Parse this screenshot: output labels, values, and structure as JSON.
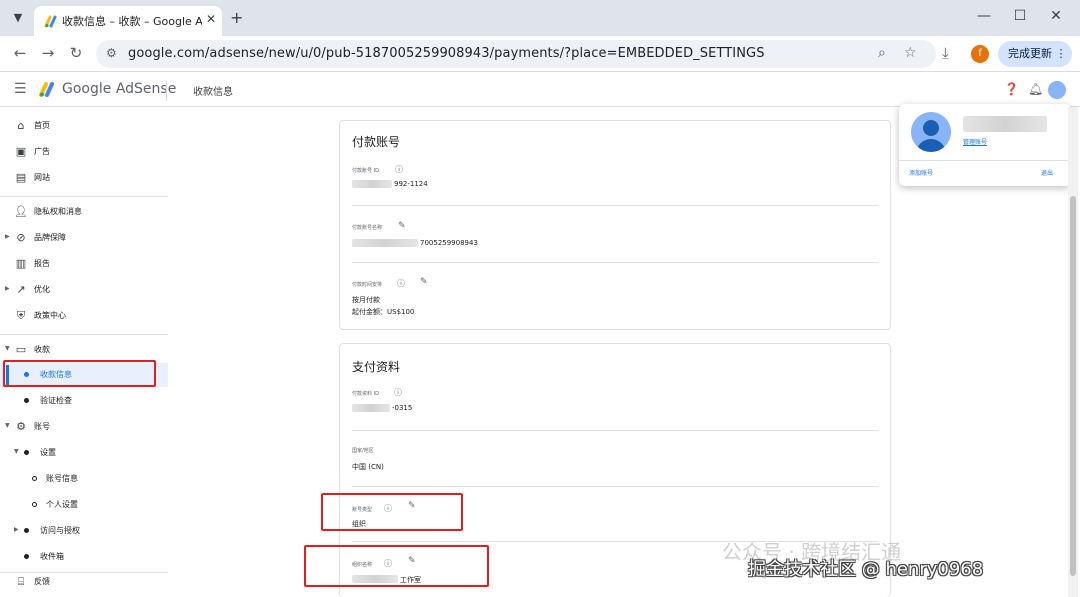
{
  "browser": {
    "tab_title": "收款信息 – 收款 – Google AdSense",
    "url": "google.com/adsense/new/u/0/pub-5187005259908943/payments/?place=EMBEDDED_SETTINGS",
    "update_label": "完成更新",
    "profile_initial": "f"
  },
  "app": {
    "logo_text": "Google AdSense",
    "page_title": "收款信息"
  },
  "sidebar": {
    "items": [
      {
        "label": "首页",
        "icon": "home-icon"
      },
      {
        "label": "广告",
        "icon": "ads-icon"
      },
      {
        "label": "网站",
        "icon": "sites-icon"
      },
      {
        "label": "隐私权和消息",
        "icon": "privacy-icon"
      },
      {
        "label": "品牌保障",
        "icon": "block-icon"
      },
      {
        "label": "报告",
        "icon": "report-icon"
      },
      {
        "label": "优化",
        "icon": "trend-icon"
      },
      {
        "label": "政策中心",
        "icon": "shield-icon"
      },
      {
        "label": "收款",
        "icon": "payments-icon"
      },
      {
        "label": "收款信息"
      },
      {
        "label": "验证检查"
      },
      {
        "label": "账号",
        "icon": "gear-icon"
      },
      {
        "label": "设置"
      },
      {
        "label": "账号信息"
      },
      {
        "label": "个人设置"
      },
      {
        "label": "访问与授权"
      },
      {
        "label": "收件箱"
      },
      {
        "label": "反馈",
        "icon": "feedback-icon"
      }
    ]
  },
  "payments_account": {
    "title": "付款账号",
    "id_label": "付款账号 ID",
    "id_value": "992-1124",
    "name_label": "付款账号名称",
    "name_value": "7005259908943",
    "schedule_label": "付款时间安排",
    "schedule_line1": "按月付款",
    "schedule_line2": "起付金额：US$100"
  },
  "payments_profile": {
    "title": "支付资料",
    "id_label": "付款资料 ID",
    "id_value": "-0315",
    "country_label": "国家/地区",
    "country_value": "中国 (CN)",
    "type_label": "账号类型",
    "type_value": "组织",
    "org_label": "组织名称",
    "org_value": "工作室"
  },
  "account_popup": {
    "manage_link": "管理账号",
    "add_account": "添加账号",
    "sign_out": "退出"
  },
  "watermark": {
    "faint": "公众号 · 跨境结汇通",
    "main": "掘金技术社区 @ henry0968"
  },
  "colors": {
    "accent": "#1a73e8",
    "annotation_red": "#e02020",
    "active_nav_bg": "#e8f0fe"
  }
}
